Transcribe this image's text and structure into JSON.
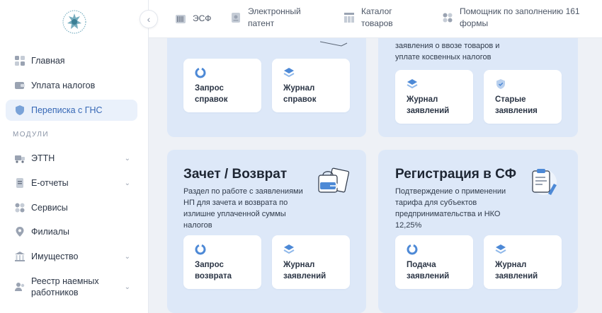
{
  "sidebar": {
    "collapse_icon": "chevron-left-icon",
    "nav": [
      {
        "label": "Главная",
        "icon": "grid-icon"
      },
      {
        "label": "Уплата налогов",
        "icon": "wallet-icon"
      },
      {
        "label": "Переписка с ГНС",
        "icon": "shield-icon",
        "active": true
      }
    ],
    "section_label": "МОДУЛИ",
    "modules": [
      {
        "label": "ЭТТН",
        "icon": "truck-icon",
        "expandable": true
      },
      {
        "label": "Е-отчеты",
        "icon": "document-icon",
        "expandable": true
      },
      {
        "label": "Сервисы",
        "icon": "grid-icon",
        "expandable": false
      },
      {
        "label": "Филиалы",
        "icon": "location-icon",
        "expandable": false
      },
      {
        "label": "Имущество",
        "icon": "building-icon",
        "expandable": true
      },
      {
        "label": "Реестр наемных работников",
        "icon": "users-icon",
        "expandable": true
      }
    ]
  },
  "topbar": {
    "items": [
      {
        "label": "ЭСФ",
        "icon": "barcode-icon"
      },
      {
        "label": "Электронный патент",
        "icon": "patent-icon"
      },
      {
        "label": "Каталог товаров",
        "icon": "catalog-icon"
      },
      {
        "label": "Помощник по заполнению 161 формы",
        "icon": "grid-icon"
      }
    ]
  },
  "cards": {
    "top_left": {
      "tiles": [
        {
          "label": "Запрос справок",
          "icon": "circle-icon"
        },
        {
          "label": "Журнал справок",
          "icon": "layers-icon"
        }
      ]
    },
    "top_right": {
      "desc": "заявления о ввозе товаров и уплате косвенных налогов",
      "tiles": [
        {
          "label": "Журнал заявлений",
          "icon": "layers-icon"
        },
        {
          "label": "Старые заявления",
          "icon": "shield-icon"
        }
      ]
    },
    "bottom_left": {
      "title": "Зачет / Возврат",
      "desc": "Раздел по работе с заявлениями НП для зачета и возврата по излишне уплаченной суммы налогов",
      "tiles": [
        {
          "label": "Запрос возврата",
          "icon": "circle-icon"
        },
        {
          "label": "Журнал заявлений",
          "icon": "layers-icon"
        }
      ]
    },
    "bottom_right": {
      "title": "Регистрация в СФ",
      "desc": "Подтверждение о применении тарифа для субъектов предпринимательства и НКО 12,25%",
      "tiles": [
        {
          "label": "Подача заявлений",
          "icon": "circle-icon"
        },
        {
          "label": "Журнал заявлений",
          "icon": "layers-icon"
        }
      ]
    }
  },
  "colors": {
    "accent": "#3567b5",
    "card_bg": "#dde8f8",
    "active_nav_bg": "#eaf1fb"
  }
}
